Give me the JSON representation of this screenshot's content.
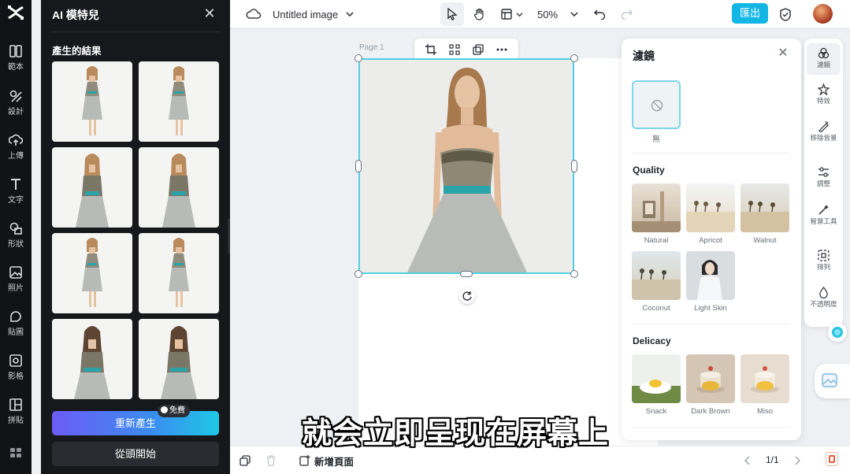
{
  "rail": {
    "items": [
      {
        "label": "範本",
        "icon": "template-icon"
      },
      {
        "label": "設計",
        "icon": "design-icon"
      },
      {
        "label": "上傳",
        "icon": "upload-icon"
      },
      {
        "label": "文字",
        "icon": "text-icon"
      },
      {
        "label": "形狀",
        "icon": "shape-icon"
      },
      {
        "label": "照片",
        "icon": "photo-icon"
      },
      {
        "label": "貼圖",
        "icon": "sticker-icon"
      },
      {
        "label": "影格",
        "icon": "frame-icon"
      },
      {
        "label": "拼貼",
        "icon": "collage-icon"
      }
    ]
  },
  "panel": {
    "title": "AI 模特兒",
    "subtitle": "產生的結果",
    "regenerate_label": "重新產生",
    "free_badge": "免費",
    "restart_label": "從頭開始"
  },
  "topbar": {
    "doc_title": "Untitled image",
    "zoom": "50%",
    "export_label": "匯出"
  },
  "canvas": {
    "page_label": "Page 1"
  },
  "filters": {
    "title": "濾鏡",
    "none_label": "無",
    "sections": [
      {
        "title": "Quality",
        "items": [
          "Natural",
          "Apricot",
          "Walnut",
          "Coconut",
          "Light Skin"
        ]
      },
      {
        "title": "Delicacy",
        "items": [
          "Snack",
          "Dark Brown",
          "Miso"
        ]
      }
    ]
  },
  "right_rail": {
    "items": [
      {
        "label": "濾鏡",
        "icon": "filter-icon"
      },
      {
        "label": "特效",
        "icon": "effects-icon"
      },
      {
        "label": "移除背景",
        "icon": "remove-bg-icon"
      },
      {
        "label": "調整",
        "icon": "adjust-icon"
      },
      {
        "label": "智慧工具",
        "icon": "smart-tools-icon"
      },
      {
        "label": "排列",
        "icon": "arrange-icon"
      },
      {
        "label": "不透明度",
        "icon": "opacity-icon"
      }
    ]
  },
  "bottombar": {
    "add_page_label": "新增頁面",
    "page_indicator": "1/1"
  },
  "caption": "就会立即呈现在屏幕上"
}
